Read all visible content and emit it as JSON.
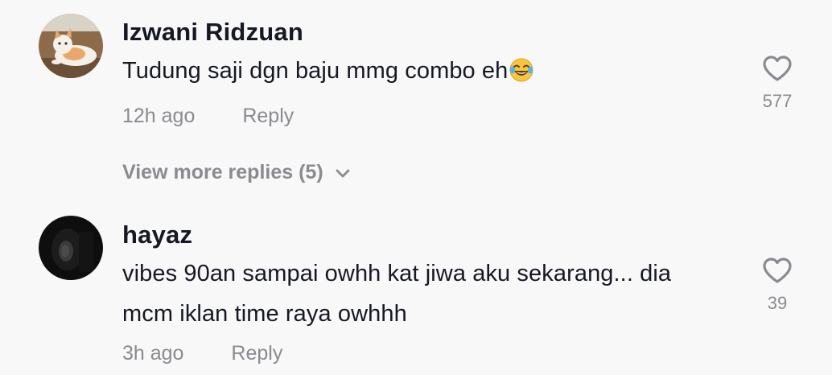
{
  "comments": [
    {
      "username": "Izwani Ridzuan",
      "text": "Tudung saji dgn baju mmg combo eh",
      "emoji": "face-with-tears-of-joy-icon",
      "time": "12h ago",
      "reply_label": "Reply",
      "likes": "577",
      "view_more": "View more replies (5)"
    },
    {
      "username": "hayaz",
      "text_line1": "vibes 90an sampai owhh kat jiwa aku sekarang... dia",
      "text_line2": "mcm iklan time raya owhhh",
      "time": "3h ago",
      "reply_label": "Reply",
      "likes": "39"
    }
  ],
  "colors": {
    "background": "#f8f8f8",
    "primary_text": "#161823",
    "secondary_text": "#8a8b91"
  }
}
